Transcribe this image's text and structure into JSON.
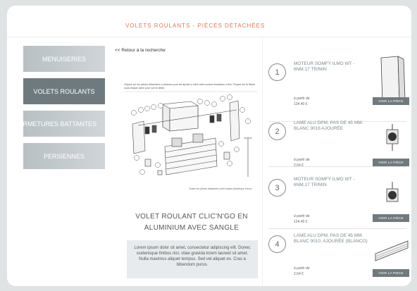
{
  "header": {
    "title": "VOLETS ROULANTS - PIÈCES DÉTACHÉES"
  },
  "sidebar": {
    "items": [
      {
        "label": "MENUISERIES",
        "active": false
      },
      {
        "label": "VOLETS ROULANTS",
        "active": true
      },
      {
        "label": "FERMETURES BATTANTES",
        "active": false
      },
      {
        "label": "PERSIENNES",
        "active": false
      }
    ]
  },
  "back_link": "<< Retour à la recherche",
  "diagram": {
    "header_text": "Cliquez sur les pièces détachées ci-dessous pour les ajouter à votre volet roulant rénovation à tirer. Cliquez sur la flèche sous chaque pièce pour voir le détail.",
    "caption": "Toutes les pièces détachées volet roulant (électrique à tirer)"
  },
  "product": {
    "title": "VOLET ROULANT CLIC'N'GO EN ALUMINIUM AVEC SANGLE",
    "description": "Lorem ipsum dolor sit amet, consectetur adipiscing elit. Donec scelerisque finibus nisi, vitae gravida lorem laoreet sit amet. Nulla maximus aliquet tempus. Sed vel aliquet ex. Cras a bibendum purus."
  },
  "parts": [
    {
      "number": "1",
      "name": "MOTEUR SOMFY ILMO WT - 6NM,17 TR/MIN",
      "price_label": "à partir de",
      "price": "124.40 €",
      "button": "VOIR LA PIÈCE",
      "icon": "motor-end-icon"
    },
    {
      "number": "2",
      "name": "LAME ALU DPM, PAS DE 45 MM. BLANC 9016 AJOURÉE",
      "price_label": "à partir de",
      "price": "2.64 €",
      "button": "VOIR LA PIÈCE",
      "icon": "motor-icon"
    },
    {
      "number": "3",
      "name": "MOTEUR SOMFY ILMO WT - 6NM,17 TR/MIN",
      "price_label": "à partir de",
      "price": "124.40 €",
      "button": "VOIR LA PIÈCE",
      "icon": "motor-icon"
    },
    {
      "number": "4",
      "name": "LAME ALU DPM, PAS DE 45 MM. BLANC 9010, AJOURÉE (BLANCO)",
      "price_label": "à partir de",
      "price": "2.64 €",
      "button": "VOIR LA PIÈCE",
      "icon": "slat-icon"
    }
  ]
}
